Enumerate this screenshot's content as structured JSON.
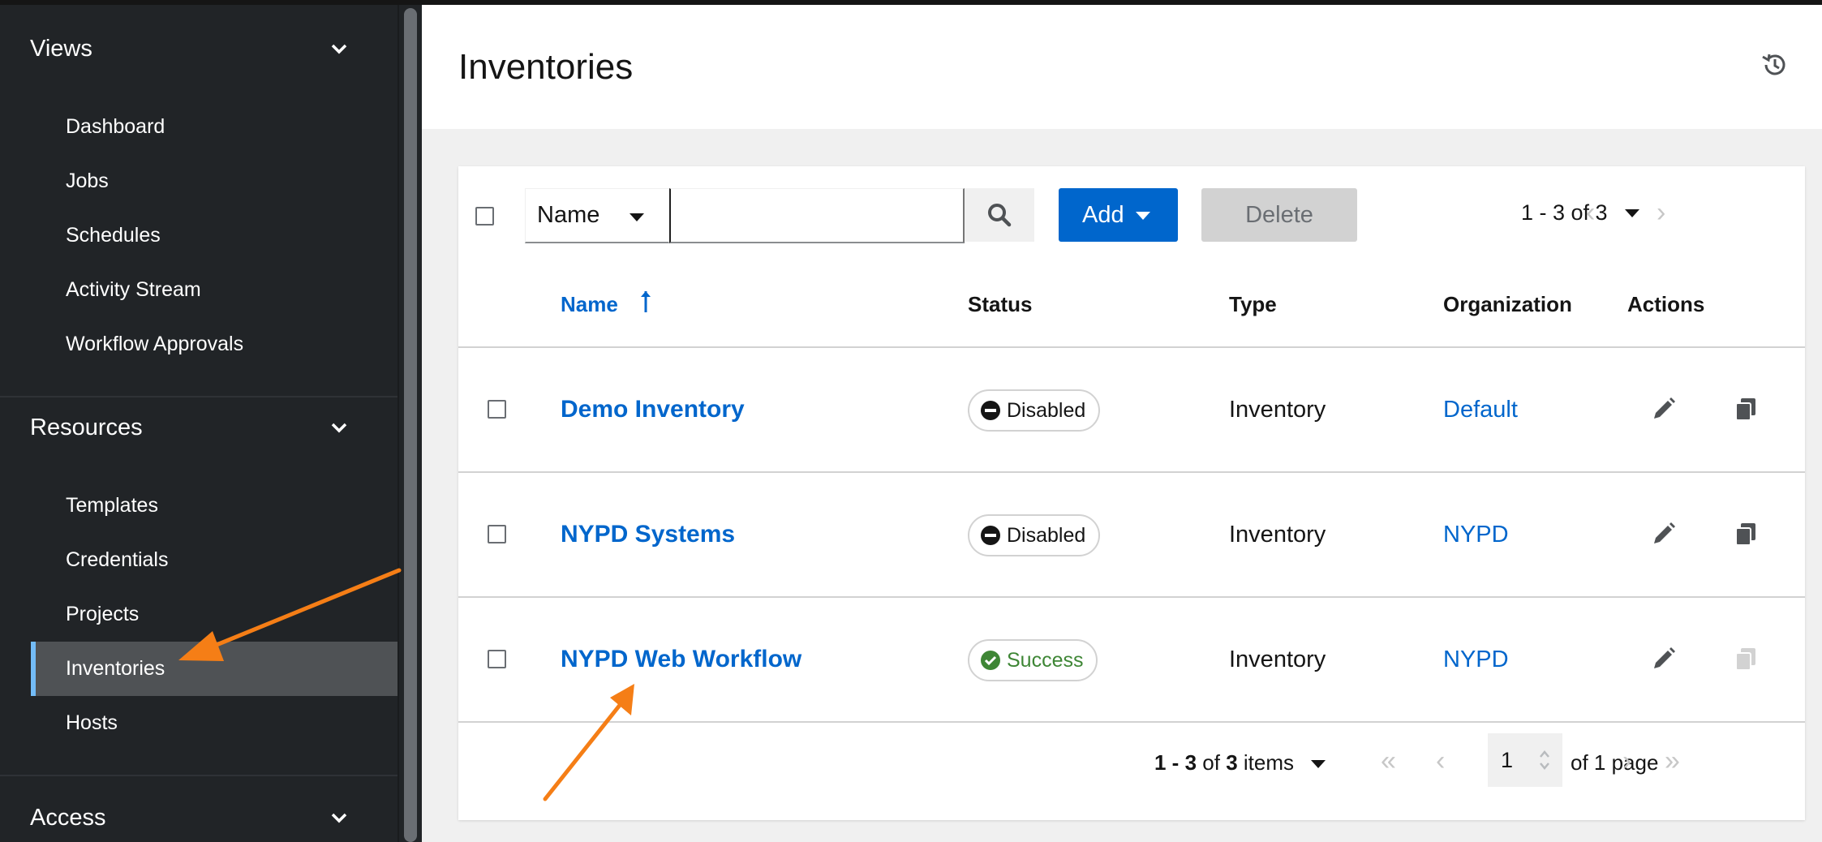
{
  "sidebar": {
    "groups": [
      {
        "label": "Views",
        "items": [
          "Dashboard",
          "Jobs",
          "Schedules",
          "Activity Stream",
          "Workflow Approvals"
        ]
      },
      {
        "label": "Resources",
        "items": [
          "Templates",
          "Credentials",
          "Projects",
          "Inventories",
          "Hosts"
        ],
        "active": "Inventories"
      },
      {
        "label": "Access",
        "items": []
      }
    ]
  },
  "header": {
    "title": "Inventories",
    "history_icon": "history-icon"
  },
  "toolbar": {
    "filter_select": "Name",
    "search_value": "",
    "add_label": "Add",
    "delete_label": "Delete",
    "pagination_label": "1 - 3 of 3"
  },
  "table": {
    "columns": [
      "Name",
      "Status",
      "Type",
      "Organization",
      "Actions"
    ],
    "sorted_column": "Name",
    "rows": [
      {
        "name": "Demo Inventory",
        "status": "Disabled",
        "type": "Inventory",
        "organization": "Default"
      },
      {
        "name": "NYPD Systems",
        "status": "Disabled",
        "type": "Inventory",
        "organization": "NYPD"
      },
      {
        "name": "NYPD Web Workflow",
        "status": "Success",
        "type": "Inventory",
        "organization": "NYPD"
      }
    ]
  },
  "footer": {
    "range": "1 - 3",
    "of_word": "of",
    "total": "3",
    "items_word": "items",
    "page_value": "1",
    "of_pages": "of 1 page"
  },
  "colors": {
    "link": "#0066cc",
    "sidebar_bg": "#212427",
    "annotation_arrow": "#f57e16",
    "success": "#3e8635"
  }
}
